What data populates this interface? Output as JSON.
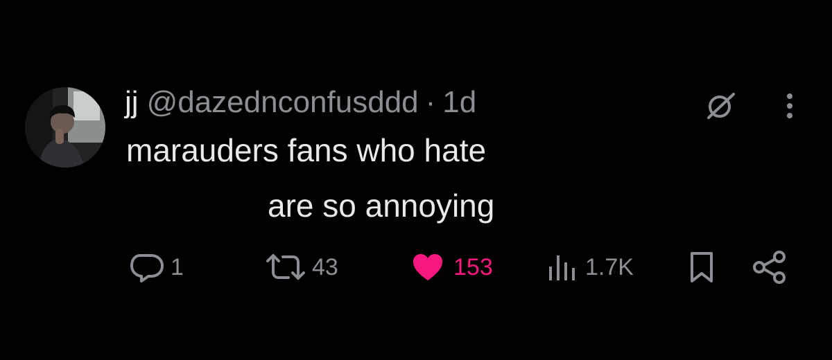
{
  "author": {
    "display_name": "jj",
    "handle": "@dazednconfusddd",
    "separator": "·",
    "time": "1d"
  },
  "post": {
    "lines": [
      "marauders fans who hate",
      "are so annoying"
    ]
  },
  "actions": {
    "reply_count": "1",
    "repost_count": "43",
    "like_count": "153",
    "view_count": "1.7K"
  },
  "icons": {
    "top": [
      "grok-icon",
      "more-icon"
    ],
    "bar": [
      "reply-icon",
      "repost-icon",
      "heart-icon",
      "views-icon",
      "bookmark-icon",
      "share-icon"
    ]
  },
  "colors": {
    "background": "#000000",
    "text": "#e7e9ea",
    "secondary": "#8b8f93",
    "like": "#f91880"
  }
}
